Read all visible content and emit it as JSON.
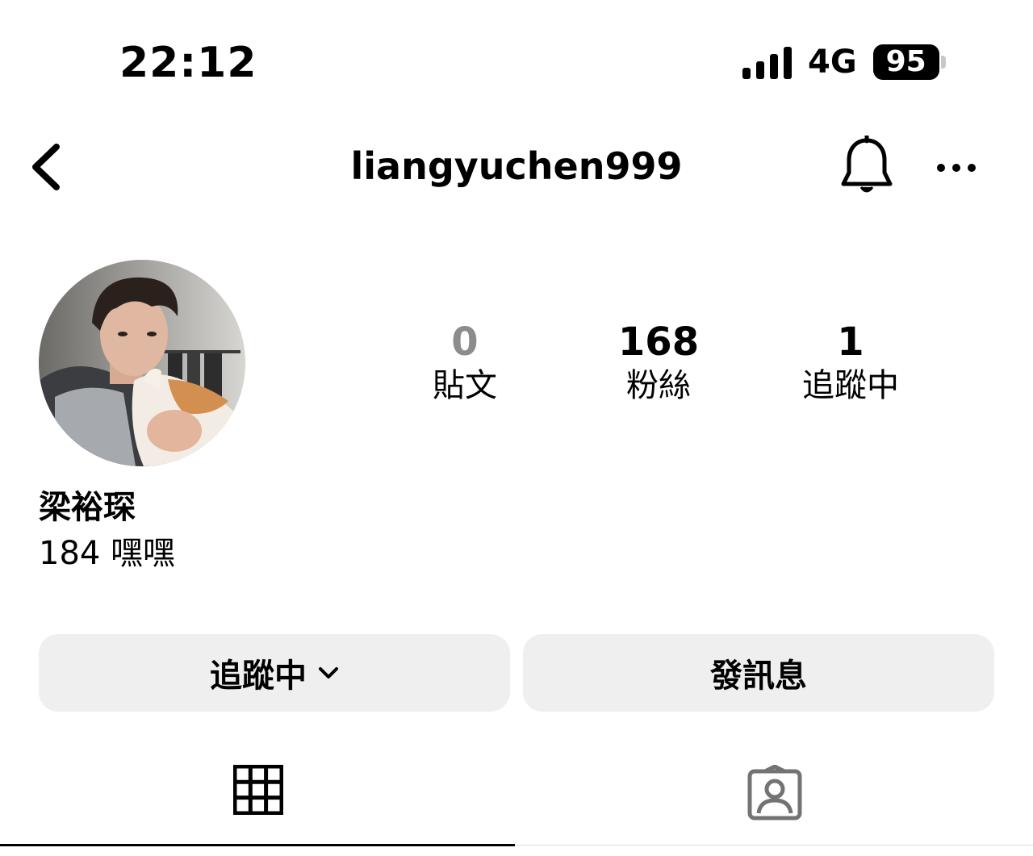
{
  "status_bar": {
    "time": "22:12",
    "network": "4G",
    "battery": "95"
  },
  "header": {
    "username": "liangyuchen999",
    "back_icon": "chevron-left-icon",
    "bell_icon": "bell-icon",
    "more_icon": "more-horizontal-icon"
  },
  "profile": {
    "display_name": "梁裕琛",
    "bio": "184 嘿嘿",
    "stats": {
      "posts": {
        "value": "0",
        "label": "貼文"
      },
      "followers": {
        "value": "168",
        "label": "粉絲"
      },
      "following": {
        "value": "1",
        "label": "追蹤中"
      }
    }
  },
  "actions": {
    "following_label": "追蹤中",
    "message_label": "發訊息"
  },
  "tabs": [
    {
      "icon": "grid-icon",
      "active": true
    },
    {
      "icon": "tagged-person-icon",
      "active": false
    }
  ],
  "colors": {
    "button_bg": "#efefef",
    "muted_number": "#8c8c8c"
  }
}
